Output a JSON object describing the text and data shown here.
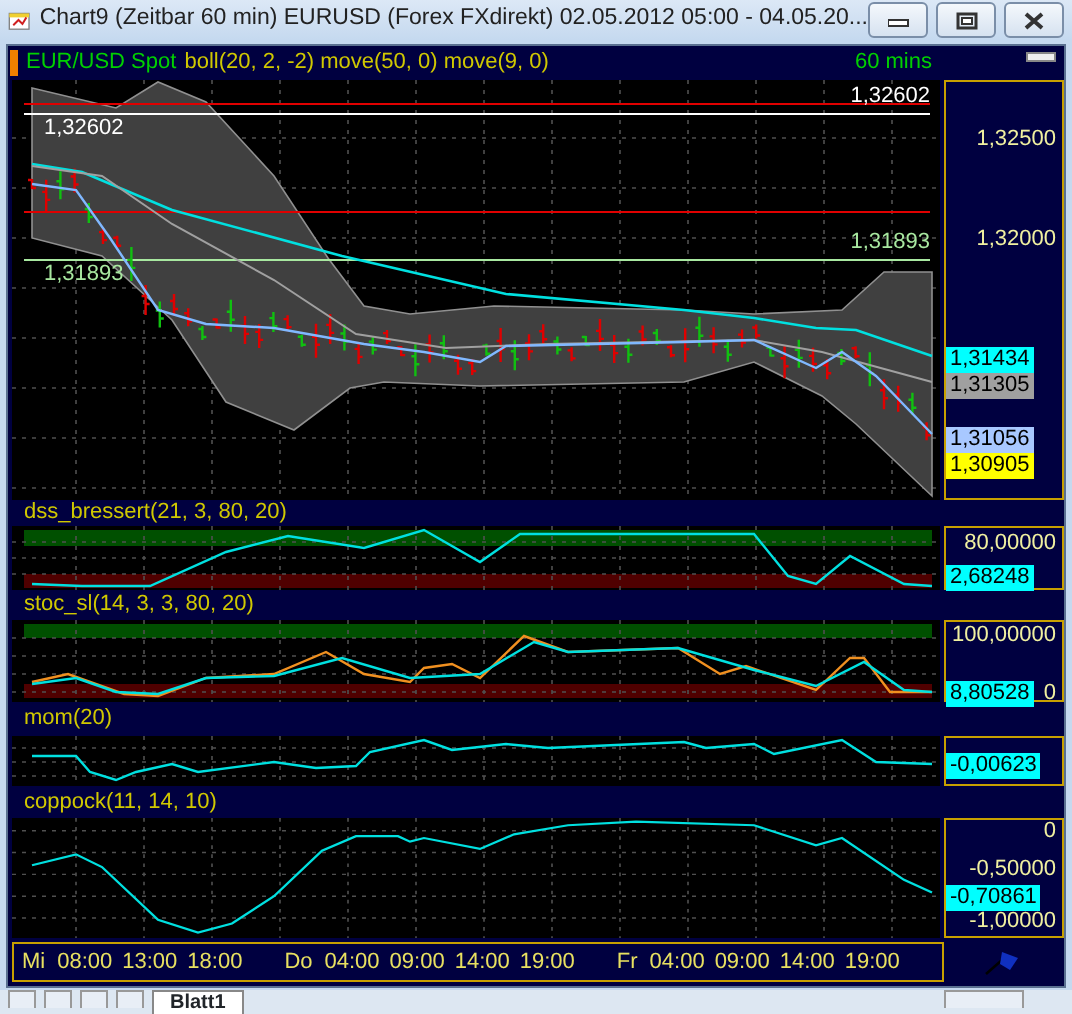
{
  "window": {
    "title": "Chart9 (Zeitbar 60 min)  EURUSD (Forex FXdirekt) 02.05.2012 05:00 - 04.05.20..."
  },
  "window_buttons": [
    {
      "kind": "minimize"
    },
    {
      "kind": "maximize"
    },
    {
      "kind": "close"
    }
  ],
  "price_panel": {
    "instrument": "EUR/USD Spot",
    "studies": "boll(20, 2, -2) move(50, 0) move(9, 0)",
    "interval": "60 mins",
    "line_labels": [
      {
        "text": "1,32602",
        "color": "#ffffff"
      },
      {
        "text": "1,32602",
        "color": "#ffffff"
      },
      {
        "text": "1,31893",
        "color": "#a8e8a0"
      },
      {
        "text": "1,31893",
        "color": "#a8e8a0"
      }
    ],
    "axis_labels": [
      "1,32500",
      "1,32000"
    ],
    "value_tags": [
      {
        "text": "1,31434",
        "color": "#00ffff"
      },
      {
        "text": "1,31305",
        "color": "#a0a0a0"
      },
      {
        "text": "1,31056",
        "color": "#a8c8ff"
      },
      {
        "text": "1,30905",
        "color": "#ffff00"
      }
    ]
  },
  "indicator_panels": [
    {
      "kind": "dss",
      "title": "dss_bressert(21, 3, 80, 20)",
      "axis_labels": [
        "80,00000"
      ],
      "value_tags": [
        {
          "text": "2,68248",
          "color": "#00ffff"
        }
      ]
    },
    {
      "kind": "stoc",
      "title": "stoc_sl(14, 3, 3, 80, 20)",
      "axis_labels": [
        "100,00000",
        "0"
      ],
      "value_tags": [
        {
          "text": "8,80528",
          "color": "#00ffff"
        }
      ]
    },
    {
      "kind": "mom",
      "title": "mom(20)",
      "value_tags": [
        {
          "text": "-0,00623",
          "color": "#00ffff"
        }
      ]
    },
    {
      "kind": "coppock",
      "title": "coppock(11, 14, 10)",
      "axis_labels": [
        "0",
        "-0,50000",
        "-1,00000"
      ],
      "value_tags": [
        {
          "text": "-0,70861",
          "color": "#00ffff"
        }
      ]
    }
  ],
  "time_axis": [
    {
      "day": "Mi",
      "times": [
        "08:00",
        "13:00",
        "18:00"
      ]
    },
    {
      "day": "Do",
      "times": [
        "04:00",
        "09:00",
        "14:00",
        "19:00"
      ]
    },
    {
      "day": "Fr",
      "times": [
        "04:00",
        "09:00",
        "14:00",
        "19:00"
      ]
    }
  ],
  "sheet_tabs": [
    {
      "label": "Blatt1",
      "selected": true
    }
  ]
}
